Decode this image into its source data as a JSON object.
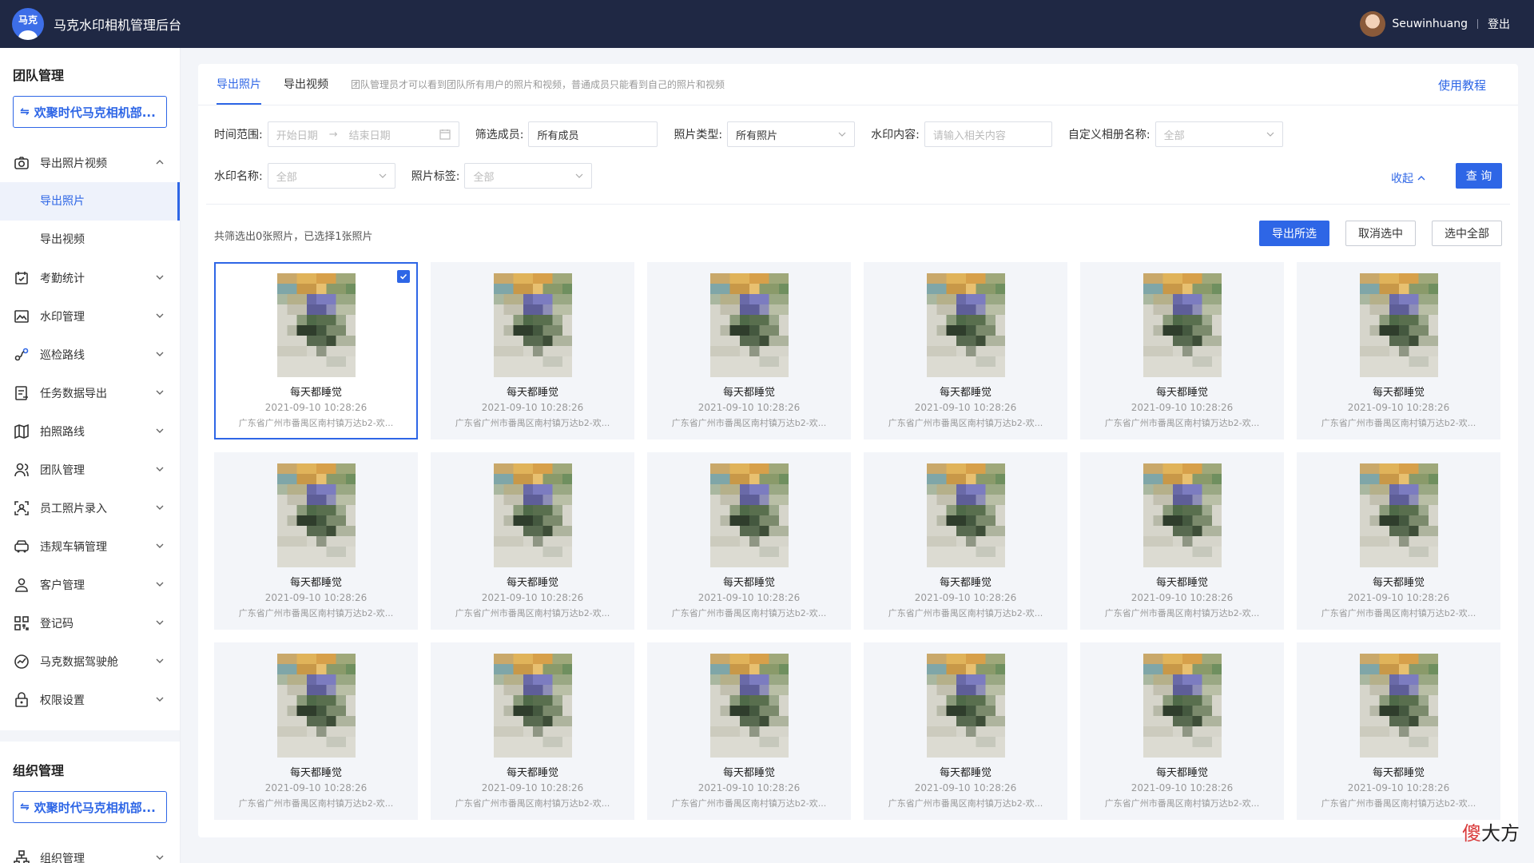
{
  "header": {
    "logo_text": "马克",
    "app_title": "马克水印相机管理后台",
    "user_name": "Seuwinhuang",
    "logout": "登出"
  },
  "sidebar": {
    "team_group_title": "团队管理",
    "team_select": "欢聚时代马克相机部...",
    "items": [
      {
        "label": "导出照片视频",
        "icon": "camera-icon",
        "expanded": true
      },
      {
        "label": "考勤统计",
        "icon": "calendar-check-icon"
      },
      {
        "label": "水印管理",
        "icon": "image-icon"
      },
      {
        "label": "巡检路线",
        "icon": "route-icon"
      },
      {
        "label": "任务数据导出",
        "icon": "task-export-icon"
      },
      {
        "label": "拍照路线",
        "icon": "map-icon"
      },
      {
        "label": "团队管理",
        "icon": "users-icon"
      },
      {
        "label": "员工照片录入",
        "icon": "face-scan-icon"
      },
      {
        "label": "违规车辆管理",
        "icon": "car-icon"
      },
      {
        "label": "客户管理",
        "icon": "customer-icon"
      },
      {
        "label": "登记码",
        "icon": "qrcode-icon"
      },
      {
        "label": "马克数据驾驶舱",
        "icon": "dashboard-icon"
      },
      {
        "label": "权限设置",
        "icon": "lock-icon"
      }
    ],
    "sub_items": [
      "导出照片",
      "导出视频"
    ],
    "org_group_title": "组织管理",
    "org_select": "欢聚时代马克相机部...",
    "org_item": "组织管理"
  },
  "tabs": {
    "export_photo": "导出照片",
    "export_video": "导出视频",
    "hint": "团队管理员才可以看到团队所有用户的照片和视频，普通成员只能看到自己的照片和视频",
    "tutorial": "使用教程"
  },
  "filters": {
    "time_label": "时间范围:",
    "start_placeholder": "开始日期",
    "end_placeholder": "结束日期",
    "member_label": "筛选成员:",
    "member_value": "所有成员",
    "photo_type_label": "照片类型:",
    "photo_type_value": "所有照片",
    "watermark_content_label": "水印内容:",
    "watermark_content_placeholder": "请输入相关内容",
    "album_label": "自定义相册名称:",
    "album_value": "全部",
    "watermark_name_label": "水印名称:",
    "watermark_name_value": "全部",
    "photo_tag_label": "照片标签:",
    "photo_tag_value": "全部",
    "collapse": "收起",
    "query": "查 询"
  },
  "results": {
    "summary": "共筛选出0张照片，已选择1张照片",
    "export_selected": "导出所选",
    "cancel_selected": "取消选中",
    "select_all": "选中全部"
  },
  "photos": [
    {
      "title": "每天都睡觉",
      "time": "2021-09-10 10:28:26",
      "location": "广东省广州市番禺区南村镇万达b2-欢...",
      "selected": true
    },
    {
      "title": "每天都睡觉",
      "time": "2021-09-10 10:28:26",
      "location": "广东省广州市番禺区南村镇万达b2-欢...",
      "selected": false
    },
    {
      "title": "每天都睡觉",
      "time": "2021-09-10 10:28:26",
      "location": "广东省广州市番禺区南村镇万达b2-欢...",
      "selected": false
    },
    {
      "title": "每天都睡觉",
      "time": "2021-09-10 10:28:26",
      "location": "广东省广州市番禺区南村镇万达b2-欢...",
      "selected": false
    },
    {
      "title": "每天都睡觉",
      "time": "2021-09-10 10:28:26",
      "location": "广东省广州市番禺区南村镇万达b2-欢...",
      "selected": false
    },
    {
      "title": "每天都睡觉",
      "time": "2021-09-10 10:28:26",
      "location": "广东省广州市番禺区南村镇万达b2-欢...",
      "selected": false
    },
    {
      "title": "每天都睡觉",
      "time": "2021-09-10 10:28:26",
      "location": "广东省广州市番禺区南村镇万达b2-欢...",
      "selected": false
    },
    {
      "title": "每天都睡觉",
      "time": "2021-09-10 10:28:26",
      "location": "广东省广州市番禺区南村镇万达b2-欢...",
      "selected": false
    },
    {
      "title": "每天都睡觉",
      "time": "2021-09-10 10:28:26",
      "location": "广东省广州市番禺区南村镇万达b2-欢...",
      "selected": false
    },
    {
      "title": "每天都睡觉",
      "time": "2021-09-10 10:28:26",
      "location": "广东省广州市番禺区南村镇万达b2-欢...",
      "selected": false
    },
    {
      "title": "每天都睡觉",
      "time": "2021-09-10 10:28:26",
      "location": "广东省广州市番禺区南村镇万达b2-欢...",
      "selected": false
    },
    {
      "title": "每天都睡觉",
      "time": "2021-09-10 10:28:26",
      "location": "广东省广州市番禺区南村镇万达b2-欢...",
      "selected": false
    },
    {
      "title": "每天都睡觉",
      "time": "2021-09-10 10:28:26",
      "location": "广东省广州市番禺区南村镇万达b2-欢...",
      "selected": false
    },
    {
      "title": "每天都睡觉",
      "time": "2021-09-10 10:28:26",
      "location": "广东省广州市番禺区南村镇万达b2-欢...",
      "selected": false
    },
    {
      "title": "每天都睡觉",
      "time": "2021-09-10 10:28:26",
      "location": "广东省广州市番禺区南村镇万达b2-欢...",
      "selected": false
    },
    {
      "title": "每天都睡觉",
      "time": "2021-09-10 10:28:26",
      "location": "广东省广州市番禺区南村镇万达b2-欢...",
      "selected": false
    },
    {
      "title": "每天都睡觉",
      "time": "2021-09-10 10:28:26",
      "location": "广东省广州市番禺区南村镇万达b2-欢...",
      "selected": false
    },
    {
      "title": "每天都睡觉",
      "time": "2021-09-10 10:28:26",
      "location": "广东省广州市番禺区南村镇万达b2-欢...",
      "selected": false
    }
  ],
  "watermark": {
    "part1": "傻",
    "part2": "大方"
  },
  "colors": {
    "primary": "#2e66e6",
    "topbar": "#1f2844",
    "background": "#f3f5f9"
  }
}
